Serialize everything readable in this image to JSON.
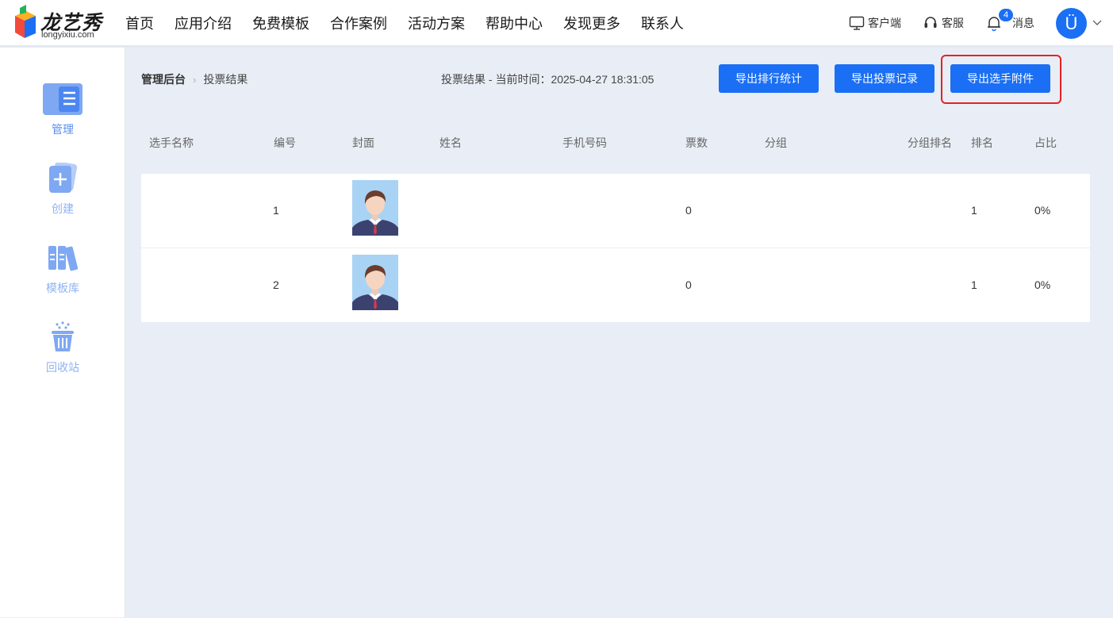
{
  "brand": {
    "name_cn": "龙艺秀",
    "name_en": "longyixiu.com"
  },
  "nav": [
    "首页",
    "应用介绍",
    "免费模板",
    "合作案例",
    "活动方案",
    "帮助中心",
    "发现更多",
    "联系人"
  ],
  "topbar": {
    "client_label": "客户端",
    "service_label": "客服",
    "messages_label": "消息",
    "message_count": "4",
    "avatar_letter": "Ü"
  },
  "sidebar": [
    {
      "label": "管理",
      "icon": "manage-icon"
    },
    {
      "label": "创建",
      "icon": "create-icon"
    },
    {
      "label": "模板库",
      "icon": "template-library-icon"
    },
    {
      "label": "回收站",
      "icon": "recycle-bin-icon"
    }
  ],
  "breadcrumb": {
    "root": "管理后台",
    "current": "投票结果"
  },
  "time_info": "投票结果 - 当前时间：2025-04-27 18:31:05",
  "buttons": {
    "export_ranking": "导出排行统计",
    "export_votes": "导出投票记录",
    "export_attachments": "导出选手附件"
  },
  "table": {
    "columns": [
      "选手名称",
      "编号",
      "封面",
      "姓名",
      "手机号码",
      "票数",
      "分组",
      "分组排名",
      "排名",
      "占比"
    ],
    "rows": [
      {
        "name": "",
        "number": "1",
        "real_name": "",
        "phone": "",
        "votes": "0",
        "group": "",
        "group_rank": "",
        "rank": "1",
        "ratio": "0%"
      },
      {
        "name": "",
        "number": "2",
        "real_name": "",
        "phone": "",
        "votes": "0",
        "group": "",
        "group_rank": "",
        "rank": "1",
        "ratio": "0%"
      }
    ]
  },
  "colors": {
    "primary": "#1a6ff5",
    "highlight": "#e52222",
    "sidebar_icon": "#8fb3f3",
    "background": "#e9eef6"
  }
}
